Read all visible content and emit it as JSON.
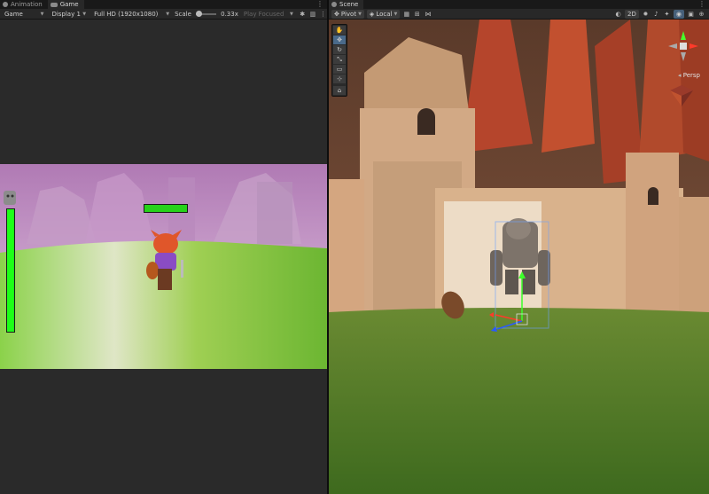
{
  "left_tabs": [
    {
      "label": "Animation",
      "icon": "animation-icon"
    },
    {
      "label": "Game",
      "icon": "game-controller-icon"
    }
  ],
  "game_toolbar": {
    "mode": "Game",
    "display": "Display 1",
    "resolution": "Full HD (1920x1080)",
    "scale_label": "Scale",
    "scale_value": "0.33x",
    "play_mode": "Play Focused"
  },
  "right_tabs": [
    {
      "label": "Scene",
      "icon": "scene-icon"
    }
  ],
  "scene_toolbar": {
    "pivot": "Pivot",
    "space": "Local",
    "toggle_2d": "2D"
  },
  "scene": {
    "camera_label": "Persp"
  },
  "game": {
    "player_health": 1.0,
    "enemy_health": 1.0
  }
}
